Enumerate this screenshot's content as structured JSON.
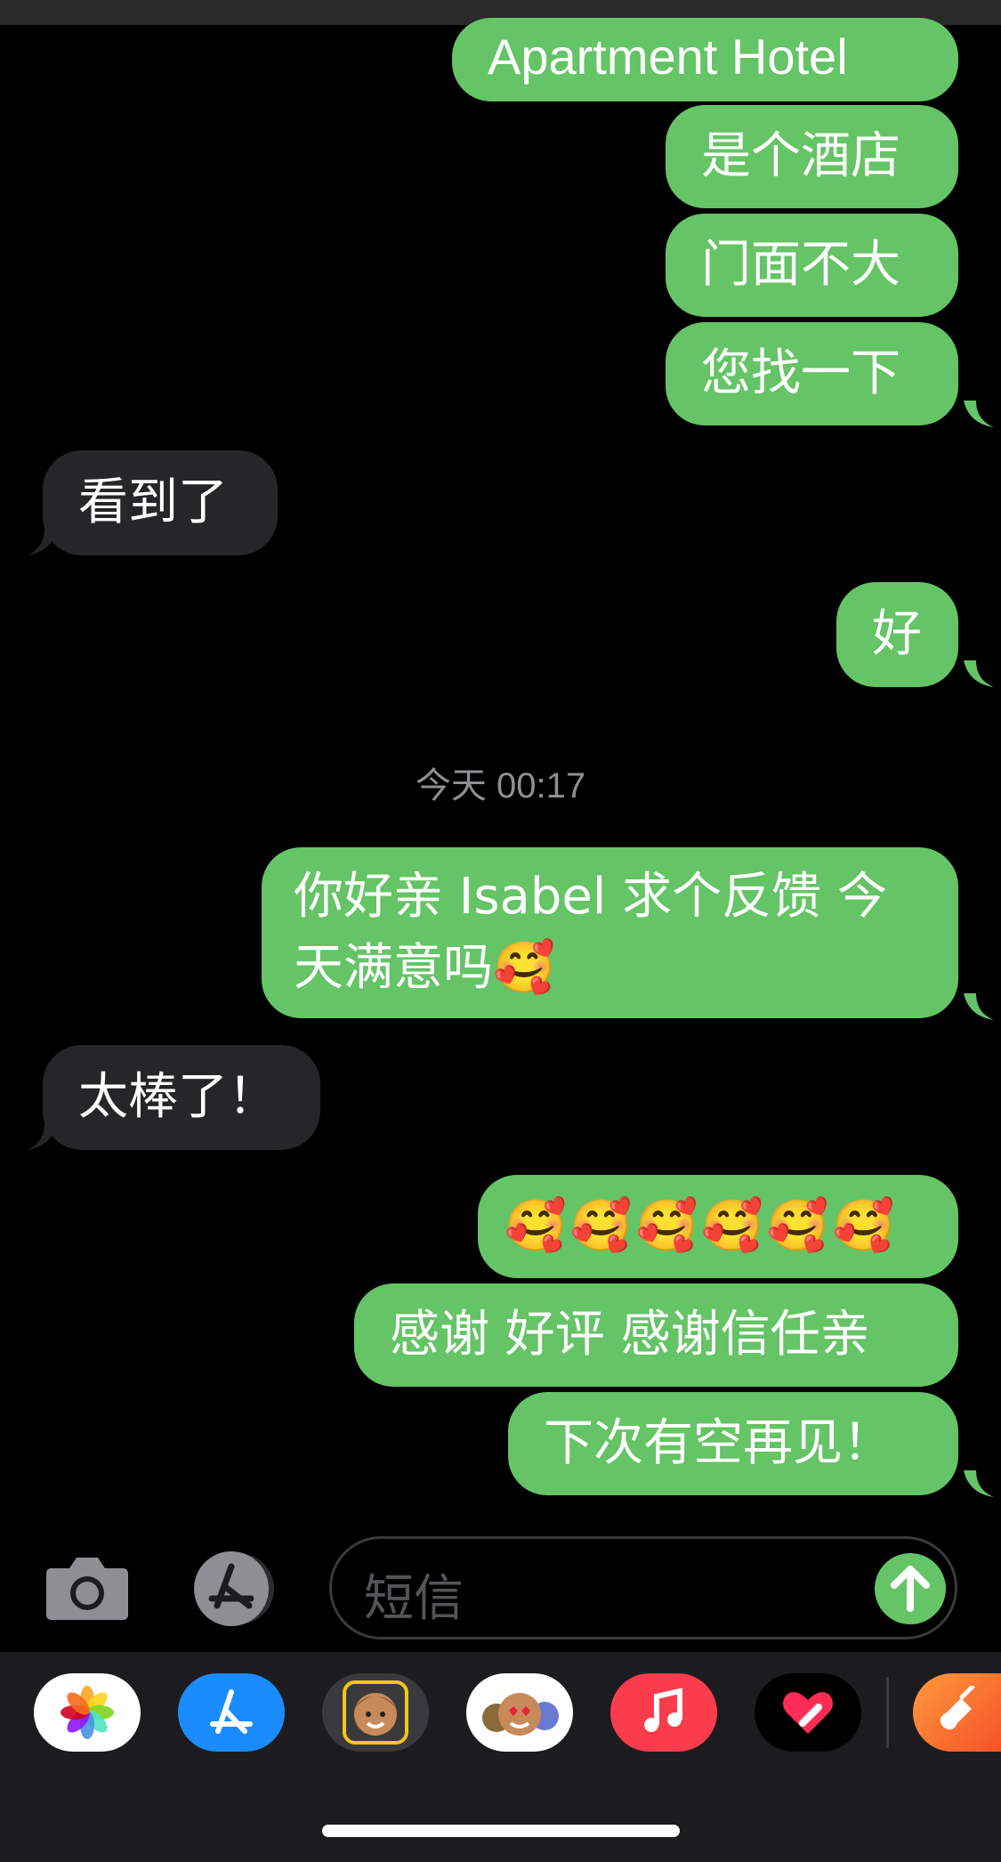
{
  "messages": {
    "sent_1": "Apartment Hotel",
    "sent_2": "是个酒店",
    "sent_3": "门面不大",
    "sent_4": "您找一下",
    "recv_1": "看到了",
    "sent_5": "好",
    "timestamp": "今天 00:17",
    "sent_6": "你好亲 Isabel 求个反馈 今天满意吗🥰",
    "recv_2": "太棒了！",
    "sent_7": "🥰🥰🥰🥰🥰🥰",
    "sent_8": "感谢 好评 感谢信任亲",
    "sent_9": "下次有空再见！"
  },
  "composer": {
    "placeholder": "短信"
  },
  "icons": {
    "camera": "camera-icon",
    "apps": "app-store-icon",
    "send": "arrow-up-icon",
    "tray": [
      "photos-icon",
      "app-store-icon",
      "memoji-icon",
      "animoji-stickers-icon",
      "music-icon",
      "digital-touch-icon",
      "garageband-icon"
    ]
  },
  "colors": {
    "sent_bubble": "#65c466",
    "received_bubble": "#262628",
    "background": "#000000"
  }
}
